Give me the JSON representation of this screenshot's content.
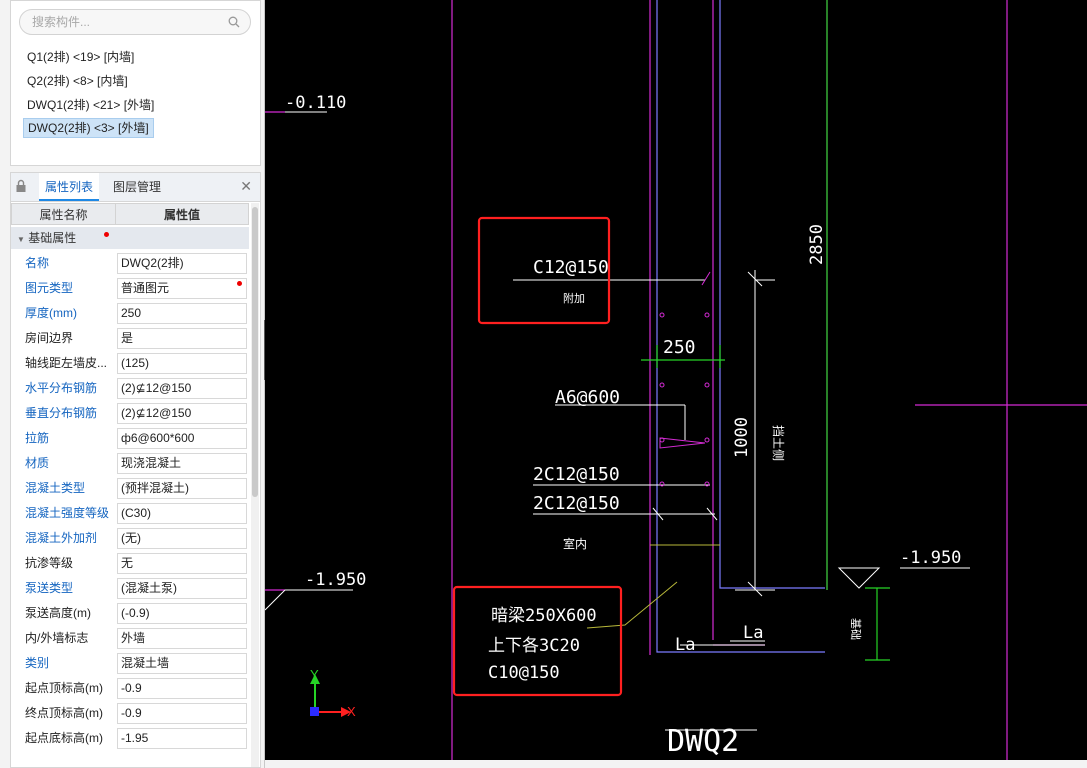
{
  "component_panel": {
    "search_placeholder": "搜索构件...",
    "items": [
      {
        "label": "Q1(2排) <19> [内墙]",
        "selected": false
      },
      {
        "label": "Q2(2排) <8> [内墙]",
        "selected": false
      },
      {
        "label": "DWQ1(2排) <21> [外墙]",
        "selected": false
      },
      {
        "label": "DWQ2(2排) <3> [外墙]",
        "selected": true
      }
    ]
  },
  "property_panel": {
    "tabs": {
      "properties": "属性列表",
      "layers": "图层管理"
    },
    "columns": {
      "name": "属性名称",
      "value": "属性值"
    },
    "group_label": "基础属性",
    "rows": [
      {
        "name": "名称",
        "value": "DWQ2(2排)",
        "blue": true
      },
      {
        "name": "图元类型",
        "value": "普通图元",
        "blue": true
      },
      {
        "name": "厚度(mm)",
        "value": "250",
        "blue": true
      },
      {
        "name": "房间边界",
        "value": "是",
        "blue": false
      },
      {
        "name": "轴线距左墙皮...",
        "value": "(125)",
        "blue": false
      },
      {
        "name": "水平分布钢筋",
        "value": "(2)⊈12@150",
        "blue": true
      },
      {
        "name": "垂直分布钢筋",
        "value": "(2)⊈12@150",
        "blue": true
      },
      {
        "name": "拉筋",
        "value": "ф6@600*600",
        "blue": true
      },
      {
        "name": "材质",
        "value": "现浇混凝土",
        "blue": true
      },
      {
        "name": "混凝土类型",
        "value": "(预拌混凝土)",
        "blue": true
      },
      {
        "name": "混凝土强度等级",
        "value": "(C30)",
        "blue": true
      },
      {
        "name": "混凝土外加剂",
        "value": "(无)",
        "blue": true
      },
      {
        "name": "抗渗等级",
        "value": "无",
        "blue": false
      },
      {
        "name": "泵送类型",
        "value": "(混凝土泵)",
        "blue": true
      },
      {
        "name": "泵送高度(m)",
        "value": "(-0.9)",
        "blue": false
      },
      {
        "name": "内/外墙标志",
        "value": "外墙",
        "blue": false
      },
      {
        "name": "类别",
        "value": "混凝土墙",
        "blue": true
      },
      {
        "name": "起点顶标高(m)",
        "value": "-0.9",
        "blue": false
      },
      {
        "name": "终点顶标高(m)",
        "value": "-0.9",
        "blue": false
      },
      {
        "name": "起点底标高(m)",
        "value": "-1.95",
        "blue": false
      }
    ]
  },
  "drawing": {
    "texts": {
      "elev_top": "-0.110",
      "elev_left": "-1.950",
      "elev_right": "-1.950",
      "rebar_top": "C12@150",
      "rebar_top_sub": "附加",
      "dim_250": "250",
      "tie": "A6@600",
      "rebar_a": "2C12@150",
      "rebar_b": "2C12@150",
      "inside": "室内",
      "beam_size": "暗梁250X600",
      "beam_bars": "上下各3C20",
      "beam_stirrup": "C10@150",
      "la_1": "La",
      "la_2": "La",
      "dim_1000": "1000",
      "outside": "挡土侧",
      "dim_2850": "2850",
      "dim_right": "基础",
      "wall_label": "DWQ2",
      "axis_y": "Y",
      "axis_x": "X"
    },
    "colors": {
      "magenta": "#d42bd4",
      "white": "#ffffff",
      "red": "#ff2020",
      "green": "#26d426",
      "blue": "#7b7bff",
      "olive": "#b8b83a"
    }
  }
}
